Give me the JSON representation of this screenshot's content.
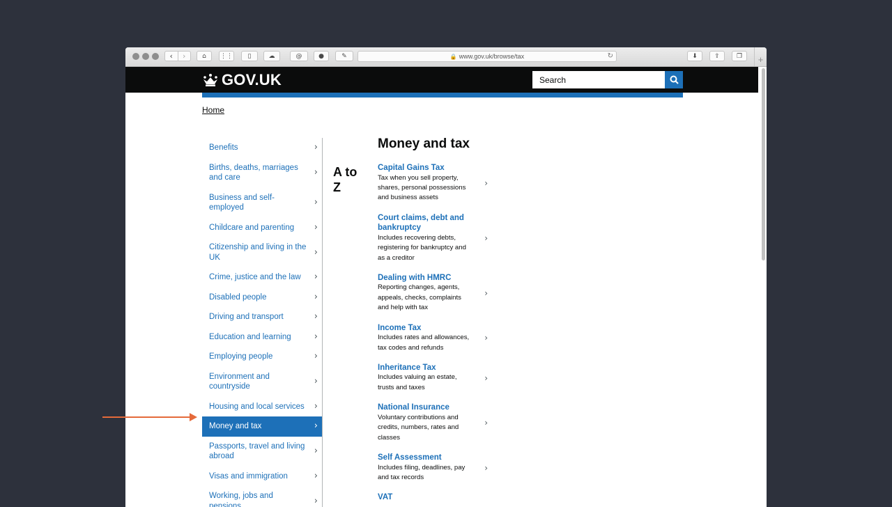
{
  "browser": {
    "url": "www.gov.uk/browse/tax"
  },
  "header": {
    "logo_text": "GOV.UK",
    "search_placeholder": "Search"
  },
  "breadcrumb": {
    "home": "Home"
  },
  "nav": {
    "items": [
      {
        "label": "Benefits",
        "active": false
      },
      {
        "label": "Births, deaths, marriages and care",
        "active": false
      },
      {
        "label": "Business and self-employed",
        "active": false
      },
      {
        "label": "Childcare and parenting",
        "active": false
      },
      {
        "label": "Citizenship and living in the UK",
        "active": false
      },
      {
        "label": "Crime, justice and the law",
        "active": false
      },
      {
        "label": "Disabled people",
        "active": false
      },
      {
        "label": "Driving and transport",
        "active": false
      },
      {
        "label": "Education and learning",
        "active": false
      },
      {
        "label": "Employing people",
        "active": false
      },
      {
        "label": "Environment and countryside",
        "active": false
      },
      {
        "label": "Housing and local services",
        "active": false
      },
      {
        "label": "Money and tax",
        "active": true
      },
      {
        "label": "Passports, travel and living abroad",
        "active": false
      },
      {
        "label": "Visas and immigration",
        "active": false
      },
      {
        "label": "Working, jobs and pensions",
        "active": false
      }
    ]
  },
  "atoz": "A to Z",
  "main": {
    "title": "Money and tax",
    "topics": [
      {
        "title": "Capital Gains Tax",
        "desc": "Tax when you sell property, shares, personal possessions and business assets"
      },
      {
        "title": "Court claims, debt and bankruptcy",
        "desc": "Includes recovering debts, registering for bankruptcy and as a creditor"
      },
      {
        "title": "Dealing with HMRC",
        "desc": "Reporting changes, agents, appeals, checks, complaints and help with tax"
      },
      {
        "title": "Income Tax",
        "desc": "Includes rates and allowances, tax codes and refunds"
      },
      {
        "title": "Inheritance Tax",
        "desc": "Includes valuing an estate, trusts and taxes"
      },
      {
        "title": "National Insurance",
        "desc": "Voluntary contributions and credits, numbers, rates and classes"
      },
      {
        "title": "Self Assessment",
        "desc": "Includes filing, deadlines, pay and tax records"
      },
      {
        "title": "VAT",
        "desc": ""
      }
    ]
  },
  "colors": {
    "link": "#1d70b8",
    "header_bg": "#0b0c0c",
    "annotation_arrow": "#e56a3a"
  }
}
